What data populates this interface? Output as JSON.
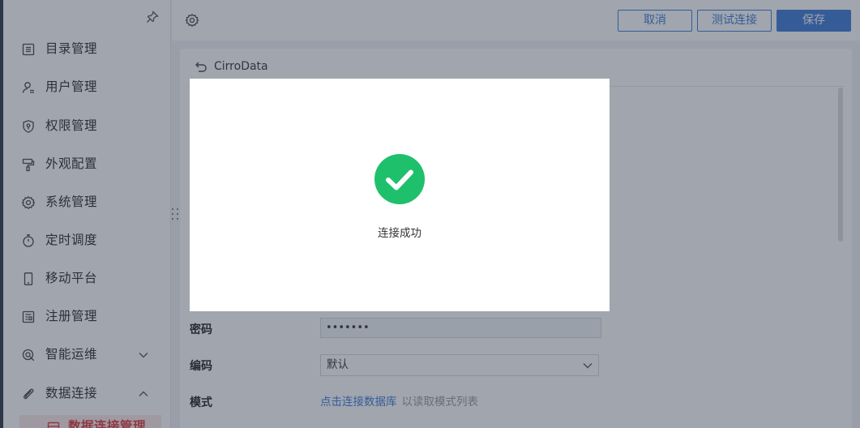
{
  "sidebar": {
    "items": [
      {
        "label": "目录管理",
        "icon": "list-icon"
      },
      {
        "label": "用户管理",
        "icon": "user-icon"
      },
      {
        "label": "权限管理",
        "icon": "shield-icon"
      },
      {
        "label": "外观配置",
        "icon": "paint-roller-icon"
      },
      {
        "label": "系统管理",
        "icon": "gear-icon"
      },
      {
        "label": "定时调度",
        "icon": "stopwatch-icon"
      },
      {
        "label": "移动平台",
        "icon": "mobile-icon"
      },
      {
        "label": "注册管理",
        "icon": "register-icon"
      },
      {
        "label": "智能运维",
        "icon": "maintenance-icon",
        "expand": "chevron-down"
      },
      {
        "label": "数据连接",
        "icon": "paperclip-icon",
        "expand": "chevron-up"
      }
    ],
    "active_sub_item": {
      "label": "数据连接管理",
      "icon": "database-icon"
    }
  },
  "toolbar": {
    "cancel_label": "取消",
    "test_label": "测试连接",
    "save_label": "保存"
  },
  "content": {
    "back_title": "CirroData",
    "form": {
      "password_label": "密码",
      "password_value": "•••••••",
      "encoding_label": "编码",
      "encoding_value": "默认",
      "schema_label": "模式",
      "schema_link": "点击连接数据库",
      "schema_hint": "以读取模式列表"
    }
  },
  "dialog": {
    "message": "连接成功",
    "icon": "success-check-icon"
  },
  "colors": {
    "accent": "#3f7ad8",
    "success": "#1fc06b",
    "active_red": "#e3393c",
    "overlay": "rgba(45,55,75,0.45)"
  }
}
